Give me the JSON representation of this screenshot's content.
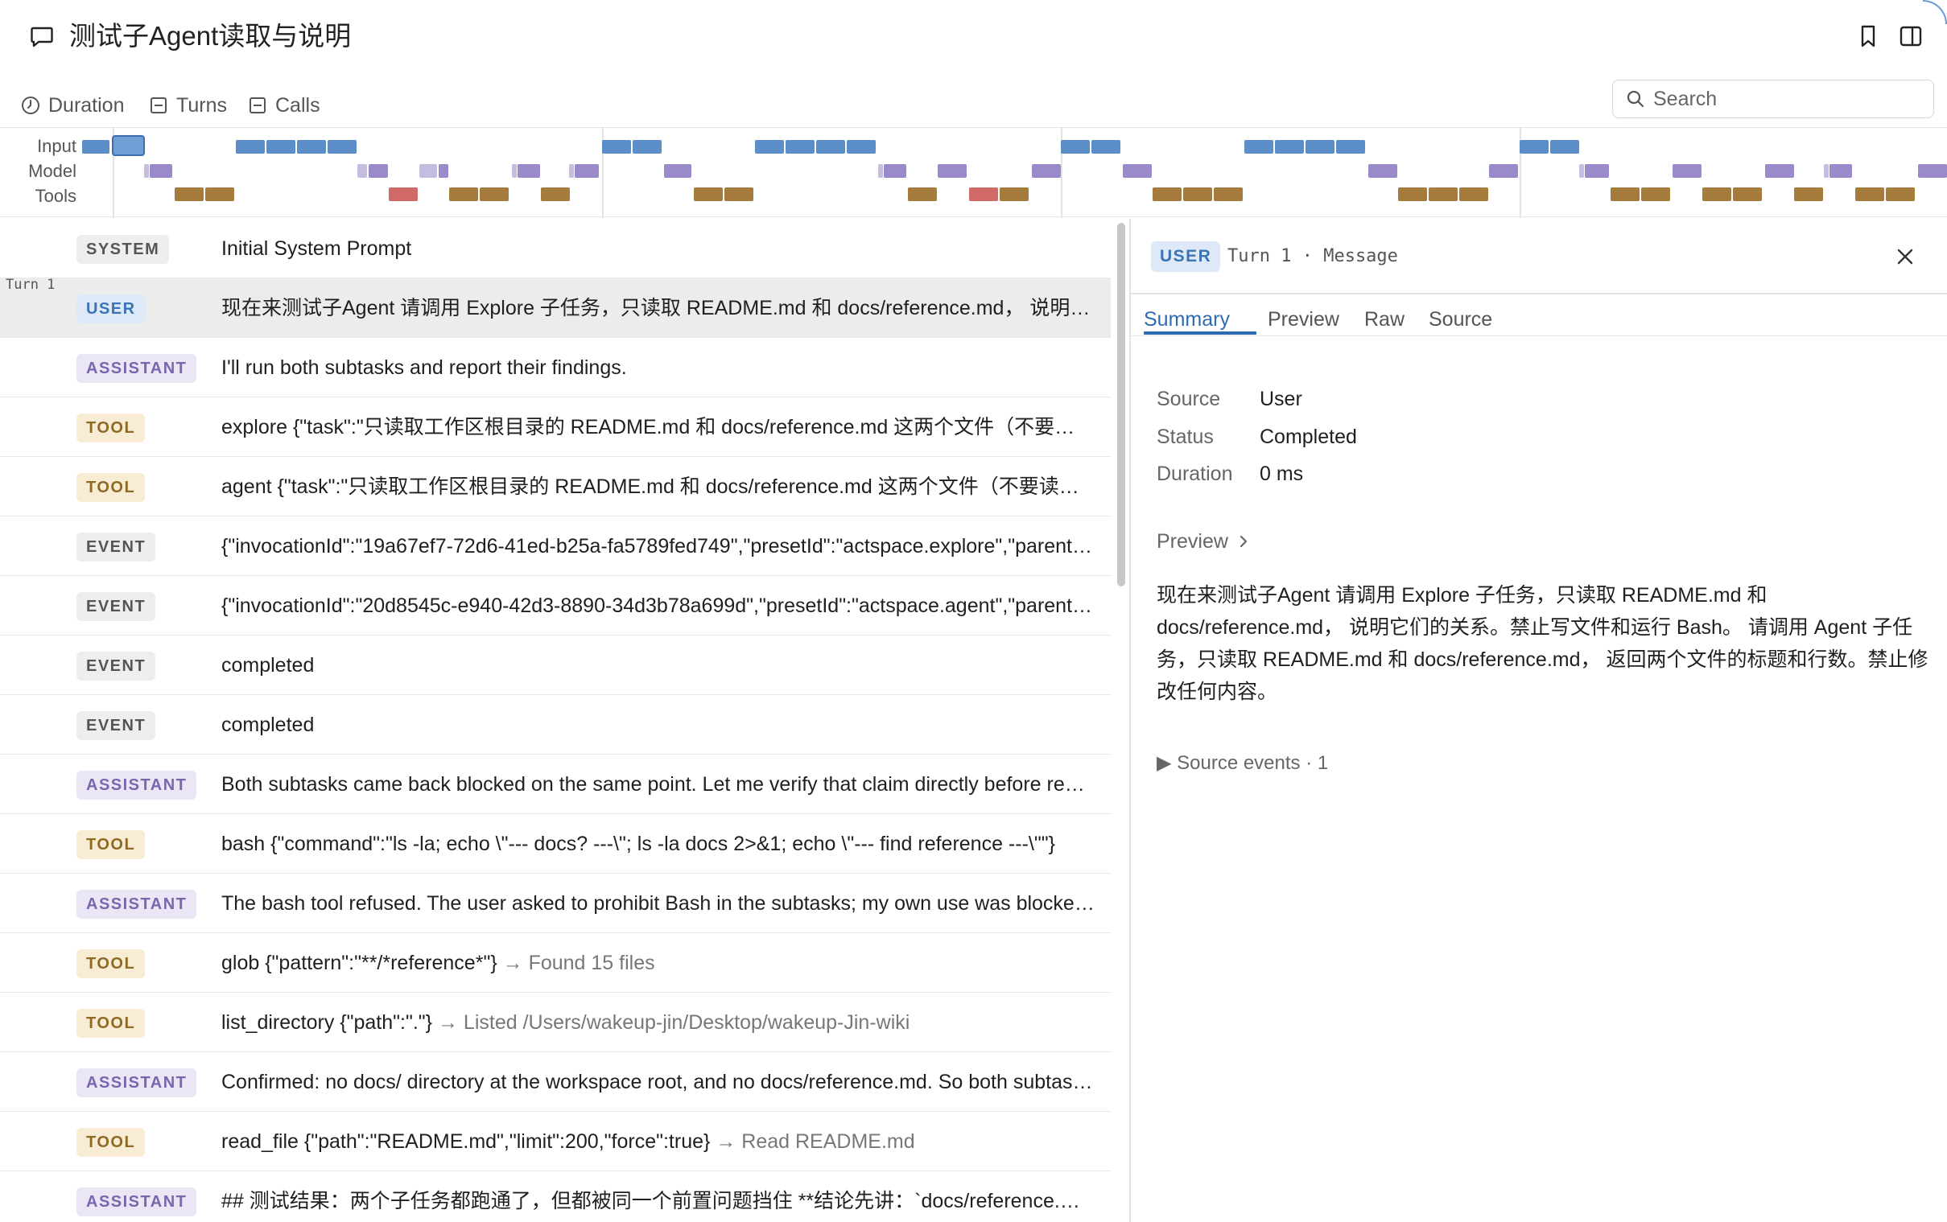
{
  "header": {
    "title": "测试子Agent读取与说明",
    "icons": [
      "message-icon",
      "bookmark-icon",
      "panel-toggle-icon"
    ]
  },
  "toolbar": {
    "duration_label": "Duration",
    "turns_label": "Turns",
    "calls_label": "Calls",
    "search_placeholder": "Search"
  },
  "timeline": {
    "row_labels": [
      "Input",
      "Model",
      "Tools"
    ],
    "colors": {
      "input": "#5b8ec7",
      "model": "#9b8ac9",
      "tool": "#a57c3b",
      "tool_error": "#d06a68"
    }
  },
  "list": {
    "turn_marker": "Turn 1",
    "rows": [
      {
        "kind": "system",
        "badge": "SYSTEM",
        "text": "Initial System Prompt",
        "result": ""
      },
      {
        "kind": "user",
        "badge": "USER",
        "text": "现在来测试子Agent 请调用 Explore 子任务，只读取 README.md 和 docs/reference.md， 说明它们的关系。禁止写文件和运行 Bash。 请调用 Agent 子任务，只读取 README.md 和 docs/reference.md， 返回两个文件的标题和行数。禁止修改任何内容。",
        "result": ""
      },
      {
        "kind": "assistant",
        "badge": "ASSISTANT",
        "text": "I'll run both subtasks and report their findings.",
        "result": ""
      },
      {
        "kind": "tool",
        "badge": "TOOL",
        "text": "explore {\"task\":\"只读取工作区根目录的 README.md 和 docs/reference.md 这两个文件（不要读取其他文件）",
        "result": ""
      },
      {
        "kind": "tool",
        "badge": "TOOL",
        "text": "agent {\"task\":\"只读取工作区根目录的 README.md 和 docs/reference.md 这两个文件（不要读取其他文件）",
        "result": ""
      },
      {
        "kind": "event",
        "badge": "EVENT",
        "text": "{\"invocationId\":\"19a67ef7-72d6-41ed-b25a-fa5789fed749\",\"presetId\":\"actspace.explore\",\"parentId\"",
        "result": ""
      },
      {
        "kind": "event",
        "badge": "EVENT",
        "text": "{\"invocationId\":\"20d8545c-e940-42d3-8890-34d3b78a699d\",\"presetId\":\"actspace.agent\",\"parentId\"",
        "result": ""
      },
      {
        "kind": "event",
        "badge": "EVENT",
        "text": "completed",
        "result": ""
      },
      {
        "kind": "event",
        "badge": "EVENT",
        "text": "completed",
        "result": ""
      },
      {
        "kind": "assistant",
        "badge": "ASSISTANT",
        "text": "Both subtasks came back blocked on the same point. Let me verify that claim directly before reporting.",
        "result": ""
      },
      {
        "kind": "tool",
        "badge": "TOOL",
        "text": "bash {\"command\":\"ls -la; echo \\\"--- docs? ---\\\"; ls -la docs 2>&1; echo \\\"--- find reference ---\\\"\"}",
        "result": ""
      },
      {
        "kind": "assistant",
        "badge": "ASSISTANT",
        "text": "The bash tool refused. The user asked to prohibit Bash in the subtasks; my own use was blocked too.",
        "result": ""
      },
      {
        "kind": "tool",
        "badge": "TOOL",
        "text": "glob {\"pattern\":\"**/*reference*\"}",
        "result": "→ Found 15 files"
      },
      {
        "kind": "tool",
        "badge": "TOOL",
        "text": "list_directory {\"path\":\".\"}",
        "result": "→ Listed /Users/wakeup-jin/Desktop/wakeup-Jin-wiki"
      },
      {
        "kind": "assistant",
        "badge": "ASSISTANT",
        "text": "Confirmed: no docs/ directory at the workspace root, and no docs/reference.md. So both subtasks were right.",
        "result": ""
      },
      {
        "kind": "tool",
        "badge": "TOOL",
        "text": "read_file {\"path\":\"README.md\",\"limit\":200,\"force\":true}",
        "result": "→ Read README.md"
      },
      {
        "kind": "assistant",
        "badge": "ASSISTANT",
        "text": "## 测试结果：两个子任务都跑通了，但都被同一个前置问题挡住 **结论先讲：`docs/reference.md` 不存在",
        "result": ""
      }
    ]
  },
  "detail": {
    "badge": "USER",
    "heading": "Turn 1 · Message",
    "tabs": [
      "Summary",
      "Preview",
      "Raw",
      "Source"
    ],
    "active_tab": "Summary",
    "fields": [
      {
        "key": "Source",
        "value": "User"
      },
      {
        "key": "Status",
        "value": "Completed"
      },
      {
        "key": "Duration",
        "value": "0 ms"
      }
    ],
    "preview_label": "Preview",
    "preview_text": "现在来测试子Agent 请调用 Explore 子任务，只读取 README.md 和 docs/reference.md， 说明它们的关系。禁止写文件和运行 Bash。 请调用 Agent 子任务，只读取 README.md 和 docs/reference.md， 返回两个文件的标题和行数。禁止修改任何内容。",
    "source_events": "▶ Source events · 1"
  }
}
